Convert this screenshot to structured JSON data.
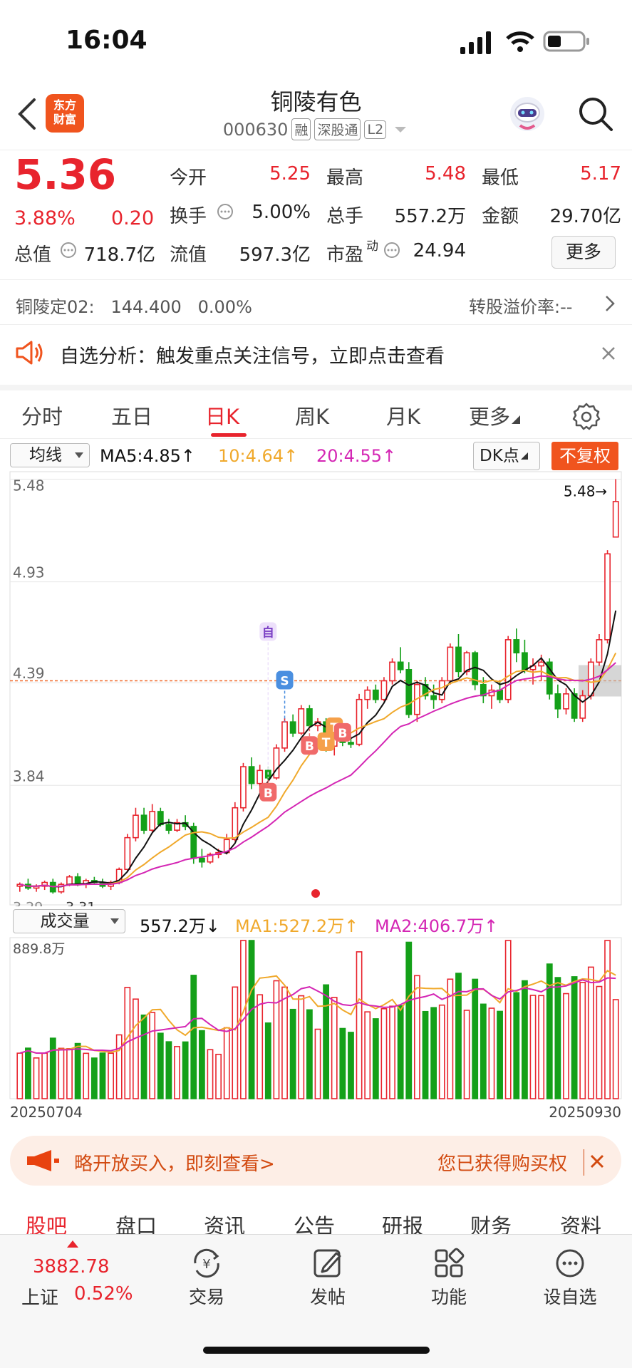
{
  "status": {
    "time": "16:04"
  },
  "header": {
    "logo_line1": "东方",
    "logo_line2": "财富",
    "name": "铜陵有色",
    "code": "000630",
    "tags": [
      "融",
      "深股通",
      "L2"
    ]
  },
  "quote": {
    "price": "5.36",
    "change_pct": "3.88%",
    "change": "0.20",
    "open_label": "今开",
    "open": "5.25",
    "high_label": "最高",
    "high": "5.48",
    "low_label": "最低",
    "low": "5.17",
    "turnover_label": "换手",
    "turnover": "5.00%",
    "volume_label": "总手",
    "volume": "557.2万",
    "amount_label": "金额",
    "amount": "29.70亿",
    "mktcap_label": "总值",
    "mktcap": "718.7亿",
    "float_label": "流值",
    "float": "597.3亿",
    "pe_label": "市盈",
    "pe_sup": "动",
    "pe": "24.94",
    "more": "更多"
  },
  "convert": {
    "left": "铜陵定02:   144.400   0.00%",
    "right": "转股溢价率:--"
  },
  "banner": {
    "text": "自选分析：触发重点关注信号，立即点击查看"
  },
  "period_tabs": [
    "分时",
    "五日",
    "日K",
    "周K",
    "月K",
    "更多"
  ],
  "ma": {
    "select": "均线",
    "ma5": "MA5:4.85↑",
    "ma10": "10:4.64↑",
    "ma20": "20:4.55↑",
    "dk": "DK点",
    "fq": "不复权"
  },
  "vol": {
    "select": "成交量",
    "value": "557.2万↓",
    "ma1": "MA1:527.2万↑",
    "ma2": "MA2:406.7万↑"
  },
  "ad": {
    "left": "略开放买入，即刻查看>",
    "right": "您已获得购买权"
  },
  "section_tabs": [
    "股吧",
    "盘口",
    "资讯",
    "公告",
    "研报",
    "财务",
    "资料"
  ],
  "bottom": {
    "index_value": "3882.78",
    "index_name": "上证",
    "index_pct": "0.52%",
    "items": [
      "交易",
      "发帖",
      "功能",
      "设自选"
    ]
  },
  "colors": {
    "up": "#e8242d",
    "down": "#14a019",
    "ma5": "#111111",
    "ma10": "#f0a92c",
    "ma20": "#d426b4",
    "accent": "#f0541e"
  },
  "chart_data": [
    {
      "type": "candlestick",
      "y_ticks": [
        "5.48",
        "4.93",
        "4.39",
        "3.84"
      ],
      "ylim": [
        3.2,
        5.52
      ],
      "high_marker": "5.48→",
      "low_labels": [
        "3.29",
        "3.31"
      ],
      "signal_labels": [
        "自",
        "S",
        "B",
        "B",
        "T",
        "T",
        "B"
      ],
      "current_price_line": 4.4,
      "ohlc": [
        [
          3.3,
          3.32,
          3.27,
          3.31
        ],
        [
          3.31,
          3.34,
          3.28,
          3.29
        ],
        [
          3.29,
          3.31,
          3.27,
          3.3
        ],
        [
          3.3,
          3.33,
          3.28,
          3.32
        ],
        [
          3.32,
          3.34,
          3.26,
          3.27
        ],
        [
          3.27,
          3.32,
          3.26,
          3.31
        ],
        [
          3.31,
          3.36,
          3.3,
          3.35
        ],
        [
          3.35,
          3.37,
          3.3,
          3.31
        ],
        [
          3.31,
          3.34,
          3.29,
          3.33
        ],
        [
          3.33,
          3.35,
          3.31,
          3.32
        ],
        [
          3.32,
          3.34,
          3.29,
          3.3
        ],
        [
          3.3,
          3.33,
          3.28,
          3.32
        ],
        [
          3.32,
          3.4,
          3.31,
          3.39
        ],
        [
          3.39,
          3.58,
          3.38,
          3.56
        ],
        [
          3.56,
          3.72,
          3.54,
          3.68
        ],
        [
          3.68,
          3.72,
          3.58,
          3.6
        ],
        [
          3.6,
          3.74,
          3.59,
          3.7
        ],
        [
          3.7,
          3.72,
          3.62,
          3.63
        ],
        [
          3.63,
          3.66,
          3.58,
          3.6
        ],
        [
          3.6,
          3.66,
          3.59,
          3.64
        ],
        [
          3.64,
          3.68,
          3.6,
          3.62
        ],
        [
          3.62,
          3.64,
          3.42,
          3.45
        ],
        [
          3.45,
          3.5,
          3.4,
          3.43
        ],
        [
          3.43,
          3.48,
          3.42,
          3.47
        ],
        [
          3.47,
          3.5,
          3.45,
          3.48
        ],
        [
          3.48,
          3.58,
          3.47,
          3.55
        ],
        [
          3.55,
          3.75,
          3.54,
          3.72
        ],
        [
          3.72,
          3.96,
          3.7,
          3.94
        ],
        [
          3.94,
          3.99,
          3.82,
          3.85
        ],
        [
          3.85,
          3.95,
          3.8,
          3.92
        ],
        [
          3.92,
          3.94,
          3.86,
          3.88
        ],
        [
          3.88,
          4.06,
          3.87,
          4.04
        ],
        [
          4.04,
          4.2,
          4.02,
          4.18
        ],
        [
          4.18,
          4.22,
          4.1,
          4.12
        ],
        [
          4.12,
          4.27,
          4.11,
          4.25
        ],
        [
          4.25,
          4.27,
          4.15,
          4.16
        ],
        [
          4.16,
          4.2,
          4.13,
          4.18
        ],
        [
          4.18,
          4.2,
          4.02,
          4.05
        ],
        [
          4.05,
          4.15,
          4.0,
          4.1
        ],
        [
          4.1,
          4.12,
          4.05,
          4.07
        ],
        [
          4.07,
          4.1,
          4.04,
          4.06
        ],
        [
          4.06,
          4.33,
          4.05,
          4.3
        ],
        [
          4.3,
          4.37,
          4.25,
          4.35
        ],
        [
          4.35,
          4.38,
          4.28,
          4.3
        ],
        [
          4.3,
          4.42,
          4.29,
          4.4
        ],
        [
          4.4,
          4.52,
          4.38,
          4.5
        ],
        [
          4.5,
          4.58,
          4.44,
          4.46
        ],
        [
          4.46,
          4.5,
          4.2,
          4.22
        ],
        [
          4.22,
          4.4,
          4.18,
          4.38
        ],
        [
          4.38,
          4.42,
          4.3,
          4.32
        ],
        [
          4.32,
          4.38,
          4.25,
          4.3
        ],
        [
          4.3,
          4.42,
          4.28,
          4.4
        ],
        [
          4.4,
          4.6,
          4.38,
          4.58
        ],
        [
          4.58,
          4.65,
          4.42,
          4.45
        ],
        [
          4.45,
          4.56,
          4.43,
          4.55
        ],
        [
          4.55,
          4.56,
          4.35,
          4.38
        ],
        [
          4.38,
          4.42,
          4.28,
          4.32
        ],
        [
          4.32,
          4.38,
          4.25,
          4.35
        ],
        [
          4.35,
          4.4,
          4.28,
          4.3
        ],
        [
          4.3,
          4.64,
          4.28,
          4.62
        ],
        [
          4.62,
          4.68,
          4.5,
          4.55
        ],
        [
          4.55,
          4.62,
          4.44,
          4.46
        ],
        [
          4.46,
          4.52,
          4.38,
          4.48
        ],
        [
          4.48,
          4.54,
          4.4,
          4.5
        ],
        [
          4.5,
          4.52,
          4.3,
          4.33
        ],
        [
          4.33,
          4.38,
          4.2,
          4.25
        ],
        [
          4.25,
          4.36,
          4.22,
          4.33
        ],
        [
          4.33,
          4.36,
          4.18,
          4.2
        ],
        [
          4.2,
          4.35,
          4.18,
          4.32
        ],
        [
          4.32,
          4.52,
          4.3,
          4.5
        ],
        [
          4.5,
          4.65,
          4.48,
          4.62
        ],
        [
          4.62,
          5.1,
          4.6,
          5.08
        ],
        [
          5.17,
          5.48,
          5.17,
          5.36
        ]
      ],
      "ma5_shape": "black",
      "ma10_shape": "orange",
      "ma20_shape": "magenta"
    },
    {
      "type": "bar",
      "title": "成交量",
      "y_ticks": [
        "889.8万"
      ],
      "x_labels": [
        "20250704",
        "20250930"
      ],
      "ylim": [
        0,
        889.8
      ]
    }
  ]
}
